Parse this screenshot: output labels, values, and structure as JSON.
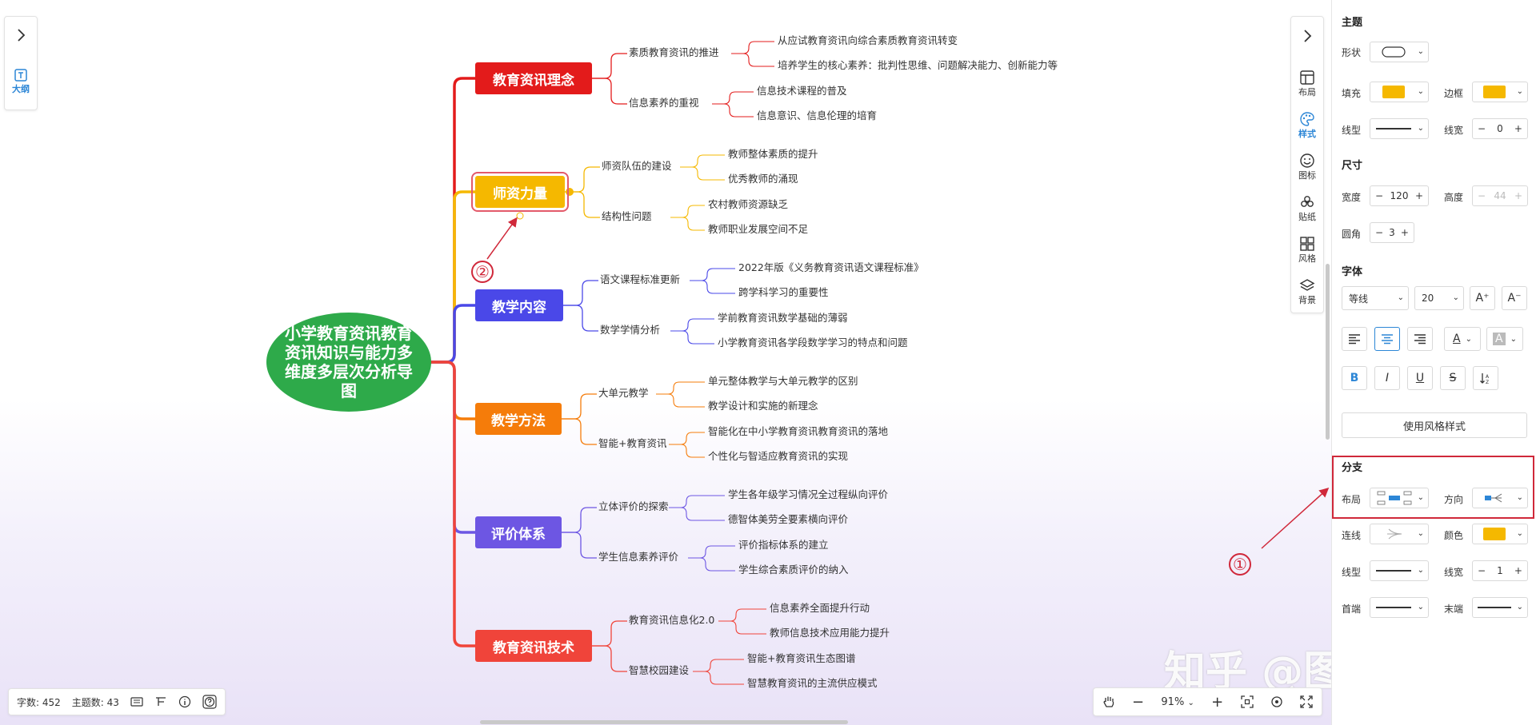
{
  "colors": {
    "root": "#2eaa4a",
    "branch1": "#e31b1b",
    "branch2": "#f5b800",
    "branch3": "#4a48e8",
    "branch4": "#f57c0a",
    "branch5": "#6d56e3",
    "branch6": "#f0443a",
    "accent": "#2c86d6",
    "highlight": "#d0283a"
  },
  "left_panel": {
    "expand_icon": "chevron-right-icon",
    "outline_icon": "text-box-icon",
    "outline_label": "大纲"
  },
  "mindmap": {
    "root": "小学教育资讯教育资讯知识与能力多维度多层次分析导图",
    "branches": [
      {
        "title": "教育资讯理念",
        "color": "#e31b1b",
        "subs": [
          {
            "label": "素质教育资讯的推进",
            "leaves": [
              "从应试教育资讯向综合素质教育资讯转变",
              "培养学生的核心素养：批判性思维、问题解决能力、创新能力等"
            ]
          },
          {
            "label": "信息素养的重视",
            "leaves": [
              "信息技术课程的普及",
              "信息意识、信息伦理的培育"
            ]
          }
        ]
      },
      {
        "title": "师资力量",
        "color": "#f5b800",
        "subs": [
          {
            "label": "师资队伍的建设",
            "leaves": [
              "教师整体素质的提升",
              "优秀教师的涌现"
            ]
          },
          {
            "label": "结构性问题",
            "leaves": [
              "农村教师资源缺乏",
              "教师职业发展空间不足"
            ]
          }
        ]
      },
      {
        "title": "教学内容",
        "color": "#4a48e8",
        "subs": [
          {
            "label": "语文课程标准更新",
            "leaves": [
              "2022年版《义务教育资讯语文课程标准》",
              "跨学科学习的重要性"
            ]
          },
          {
            "label": "数学学情分析",
            "leaves": [
              "学前教育资讯数学基础的薄弱",
              "小学教育资讯各学段数学学习的特点和问题"
            ]
          }
        ]
      },
      {
        "title": "教学方法",
        "color": "#f57c0a",
        "subs": [
          {
            "label": "大单元教学",
            "leaves": [
              "单元整体教学与大单元教学的区别",
              "教学设计和实施的新理念"
            ]
          },
          {
            "label": "智能+教育资讯",
            "leaves": [
              "智能化在中小学教育资讯教育资讯的落地",
              "个性化与智适应教育资讯的实现"
            ]
          }
        ]
      },
      {
        "title": "评价体系",
        "color": "#6d56e3",
        "subs": [
          {
            "label": "立体评价的探索",
            "leaves": [
              "学生各年级学习情况全过程纵向评价",
              "德智体美劳全要素横向评价"
            ]
          },
          {
            "label": "学生信息素养评价",
            "leaves": [
              "评价指标体系的建立",
              "学生综合素质评价的纳入"
            ]
          }
        ]
      },
      {
        "title": "教育资讯技术",
        "color": "#f0443a",
        "subs": [
          {
            "label": "教育资讯信息化2.0",
            "leaves": [
              "信息素养全面提升行动",
              "教师信息技术应用能力提升"
            ]
          },
          {
            "label": "智慧校园建设",
            "leaves": [
              "智能+教育资讯生态图谱",
              "智慧教育资讯的主流供应模式"
            ]
          }
        ]
      }
    ]
  },
  "annotations": {
    "callout_1": "①",
    "callout_2": "②"
  },
  "toolbar": {
    "collapse_icon": "chevron-right-icon",
    "items": [
      {
        "label": "布局",
        "icon": "layout-icon"
      },
      {
        "label": "样式",
        "icon": "palette-icon"
      },
      {
        "label": "图标",
        "icon": "smiley-icon"
      },
      {
        "label": "贴纸",
        "icon": "sticker-icon"
      },
      {
        "label": "风格",
        "icon": "grid-icon"
      },
      {
        "label": "背景",
        "icon": "layers-icon"
      }
    ]
  },
  "status": {
    "word_count": "字数: 452",
    "topic_count": "主题数: 43"
  },
  "zoom": {
    "value": "91%"
  },
  "watermark": "知乎 @图形天下",
  "panel": {
    "theme": {
      "title": "主题",
      "shape_label": "形状",
      "fill_label": "填充",
      "fill_color": "#f5b800",
      "border_label": "边框",
      "border_color": "#f5b800",
      "line_type_label": "线型",
      "line_width_label": "线宽",
      "line_width": "0"
    },
    "size": {
      "title": "尺寸",
      "width_label": "宽度",
      "width": "120",
      "height_label": "高度",
      "height": "44",
      "radius_label": "圆角",
      "radius": "3"
    },
    "font": {
      "title": "字体",
      "family": "等线",
      "size": "20",
      "grow": "A⁺",
      "shrink": "A⁻",
      "color_glyph": "A",
      "bg_glyph": "A",
      "bold": "B",
      "italic": "I",
      "underline": "U",
      "strike": "S",
      "style_button": "使用风格样式"
    },
    "branch": {
      "title": "分支",
      "layout_label": "布局",
      "direction_label": "方向",
      "connector_label": "连线",
      "color_label": "颜色",
      "color": "#f5b800",
      "line_type_label": "线型",
      "line_width_label": "线宽",
      "line_width": "1",
      "start_label": "首端",
      "end_label": "末端"
    }
  }
}
